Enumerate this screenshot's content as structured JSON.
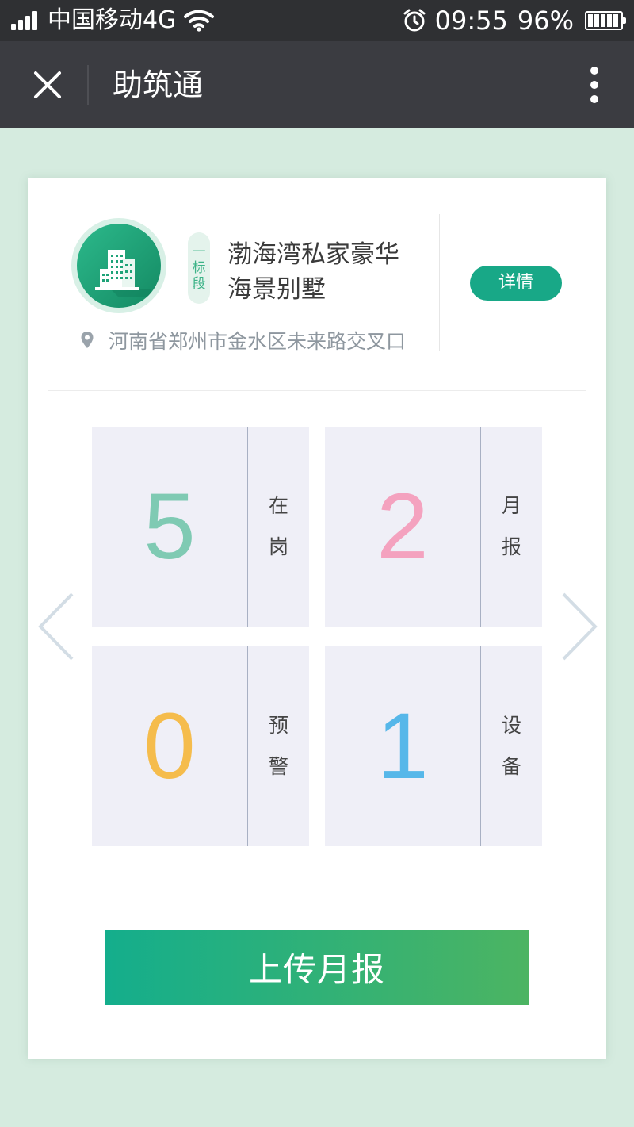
{
  "status_bar": {
    "carrier": "中国移动4G",
    "time": "09:55",
    "battery_percent": "96%",
    "battery_level": 0.96
  },
  "title_bar": {
    "title": "助筑通"
  },
  "project": {
    "section_tag": [
      "一",
      "标",
      "段"
    ],
    "name_line1": "渤海湾私家豪华",
    "name_line2": "海景别墅",
    "address": "河南省郑州市金水区未来路交叉口",
    "detail_label": "详情"
  },
  "stats": [
    {
      "value": "5",
      "label_top": "在",
      "label_bottom": "岗",
      "color": "#7fcab3"
    },
    {
      "value": "2",
      "label_top": "月",
      "label_bottom": "报",
      "color": "#f4a2bf"
    },
    {
      "value": "0",
      "label_top": "预",
      "label_bottom": "警",
      "color": "#f5bc4c"
    },
    {
      "value": "1",
      "label_top": "设",
      "label_bottom": "备",
      "color": "#56b7e9"
    }
  ],
  "upload_button": "上传月报",
  "icons": {
    "close": "close-icon",
    "more": "more-vertical-icon",
    "building": "building-icon",
    "location": "location-pin-icon",
    "prev": "chevron-left-icon",
    "next": "chevron-right-icon"
  },
  "colors": {
    "accent": "#18a887",
    "background": "#d5ebdf"
  }
}
